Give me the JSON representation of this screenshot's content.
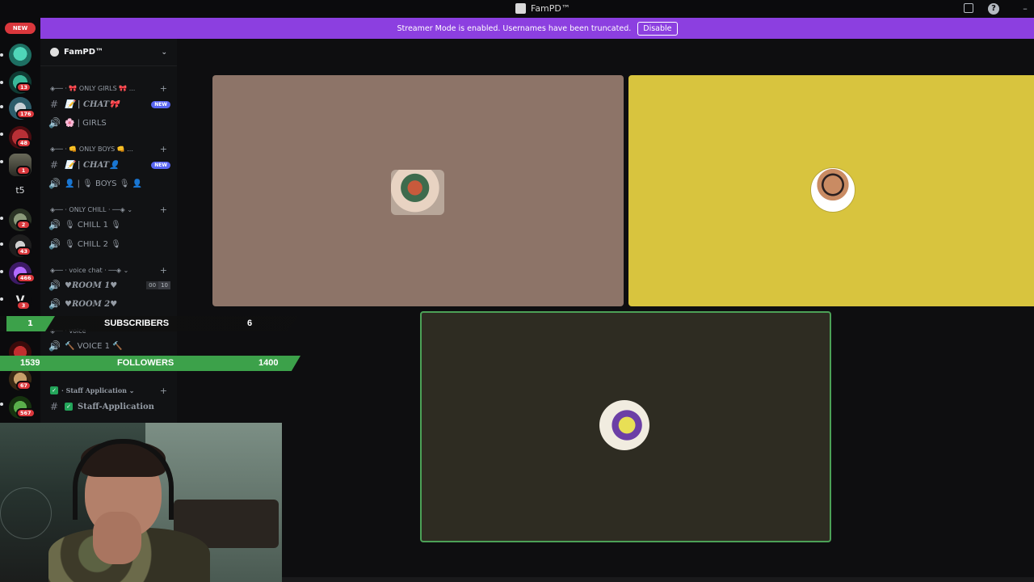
{
  "titlebar": {
    "app_name": "FamPD™"
  },
  "banner": {
    "text": "Streamer Mode is enabled. Usernames have been truncated.",
    "button": "Disable"
  },
  "server_list": {
    "new_label": "NEW",
    "text_server": "t5",
    "badges": [
      "13",
      "176",
      "48",
      "1",
      "2",
      "43",
      "466",
      "3",
      "67",
      "567"
    ]
  },
  "guild": {
    "name": "FamPD™"
  },
  "categories": {
    "girls": "◈── · 🎀 ONLY GIRLS 🎀 ...",
    "boys": "◈── · 👊 ONLY BOYS 👊 ...",
    "chill": "◈── · ONLY CHILL · ──◈ ⌄",
    "voice_chat": "◈── · voice chat · ──◈ ⌄",
    "voice": "◈── · voice",
    "staff": "· Staff Application ⌄"
  },
  "channels": {
    "girls_chat": "📝 | CHAT🎀",
    "girls_voice": "🌸 | GIRLS",
    "boys_chat": "📝 | CHAT👤",
    "boys_voice": "👤 | 🎙 BOYS 🎙 👤",
    "chill1": "🎙 CHILL 1 🎙",
    "chill2": "🎙 CHILL 2 🎙",
    "room1": "♥ROOM 1♥",
    "room1_count": [
      "00",
      "10"
    ],
    "room2": "♥ROOM 2♥",
    "voice1": "🔨 VOICE 1 🔨",
    "staff_app": "Staff-Application"
  },
  "new_tag": "NEW",
  "stream_overlay": {
    "subs_count": "1",
    "subs_label": "SUBSCRIBERS",
    "subs_goal": "6",
    "followers_count": "1539",
    "followers_label": "FOLLOWERS",
    "followers_goal": "1400"
  },
  "colors": {
    "banner": "#8c3fe0",
    "tile_1": "#8d7468",
    "tile_2": "#d8c43e",
    "tile_3": "#2e2c22",
    "speaking_border": "#4ca157",
    "overlay_green": "#3ca14a"
  }
}
